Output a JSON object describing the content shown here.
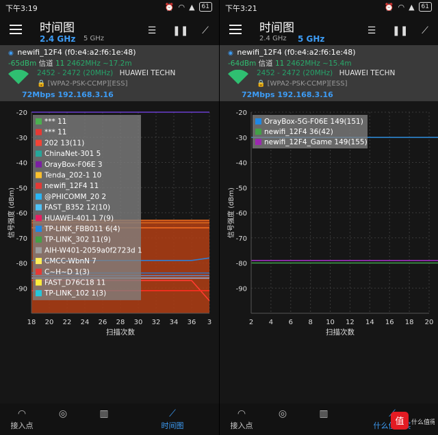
{
  "colors": {
    "accent": "#3d9cf5",
    "signal_green": "#2fbf71",
    "panel_bg": "#161616",
    "info_bg": "#3a3a3a"
  },
  "panels": [
    {
      "status_time": "下午3:19",
      "battery": "61",
      "title": "时间图",
      "band_active": "2.4 GHz",
      "band_inactive": "5 GHz",
      "ssid_line": "newifi_12F4 (f0:e4:a2:f6:1e:48)",
      "dbm": "-65dBm",
      "channel_label": "信道",
      "channel": "11",
      "freq": "2462MHz ~17.2m",
      "range": "2452 - 2472 (20MHz)",
      "vendor": "HUAWEI TECHN",
      "security": "[WPA2-PSK-CCMP][ESS]",
      "rate_ip": "72Mbps 192.168.3.16",
      "nav": [
        "接入点",
        "",
        "",
        "时间图"
      ],
      "corner_text": ""
    },
    {
      "status_time": "下午3:21",
      "battery": "61",
      "title": "时间图",
      "band_active": "5 GHz",
      "band_inactive": "2.4 GHz",
      "ssid_line": "newifi_12F4 (f0:e4:a2:f6:1e:48)",
      "dbm": "-64dBm",
      "channel_label": "信道",
      "channel": "11",
      "freq": "2462MHz ~15.4m",
      "range": "2452 - 2472 (20MHz)",
      "vendor": "HUAWEI TECHN",
      "security": "[WPA2-PSK-CCMP][ESS]",
      "rate_ip": "72Mbps 192.168.3.16",
      "nav": [
        "接入点",
        "",
        "",
        "什么值得买"
      ],
      "corner_text": "值 什么值得买"
    }
  ],
  "chart_data": [
    {
      "type": "line",
      "ylabel": "信号强度 (dBm)",
      "xlabel": "扫描次数",
      "ylim": [
        -100,
        -20
      ],
      "yticks": [
        "-20",
        "-30",
        "-40",
        "-50",
        "-60",
        "-70",
        "-80",
        "-90"
      ],
      "xticks": [
        "18",
        "20",
        "22",
        "24",
        "26",
        "28",
        "30",
        "32",
        "34",
        "36",
        "3"
      ],
      "grid": true,
      "legend_placement": "top-left",
      "legend": [
        {
          "label": "*** 11",
          "color": "#4caf50"
        },
        {
          "label": "*** 11",
          "color": "#e53935"
        },
        {
          "label": "202 13(11)",
          "color": "#f44336"
        },
        {
          "label": "ChinaNet-301 5",
          "color": "#26a69a"
        },
        {
          "label": "OrayBox-F06E 3",
          "color": "#7b1fa2"
        },
        {
          "label": "Tenda_202-1 10",
          "color": "#fbc02d"
        },
        {
          "label": "newifi_12F4 11",
          "color": "#e53935"
        },
        {
          "label": "@PHICOMM_20 2",
          "color": "#29b6f6"
        },
        {
          "label": "FAST_B352 12(10)",
          "color": "#4fc3f7"
        },
        {
          "label": "HUAWEI-401.1 7(9)",
          "color": "#e91e63"
        },
        {
          "label": "TP-LINK_FBB011 6(4)",
          "color": "#1e88e5"
        },
        {
          "label": "TP-LINK_302 11(9)",
          "color": "#43a047"
        },
        {
          "label": "AIH-W401-2059a0f2723d 1",
          "color": "#9e9e9e"
        },
        {
          "label": "CMCC-WbnN 7",
          "color": "#ffee58"
        },
        {
          "label": "C~H~D 1(3)",
          "color": "#e53935"
        },
        {
          "label": "FAST_D76C18 11",
          "color": "#ffeb3b"
        },
        {
          "label": "TP-LINK_102 1(3)",
          "color": "#26c6da"
        }
      ],
      "series": [
        {
          "color": "#6a3fd1",
          "values": [
            -20,
            -20,
            -20,
            -20,
            -20,
            -20,
            -20,
            -20,
            -20,
            -20,
            -20
          ]
        },
        {
          "color": "#e8681e",
          "values": [
            -63,
            -63,
            -63,
            -63,
            -63,
            -63,
            -63,
            -63,
            -63,
            -63,
            -63
          ]
        },
        {
          "color": "#d8651c",
          "values": [
            -64,
            -64,
            -64,
            -64,
            -64,
            -64,
            -64,
            -64,
            -64,
            -64,
            -64
          ]
        },
        {
          "color": "#f06a20",
          "values": [
            -66,
            -66,
            -66,
            -66,
            -66,
            -66,
            -66,
            -66,
            -66,
            -66,
            -66
          ]
        },
        {
          "color": "#2f7fd6",
          "values": [
            -79,
            -79,
            -79,
            -79,
            -79,
            -79,
            -79,
            -79,
            -79,
            -79,
            -78
          ]
        },
        {
          "color": "#3a6fb3",
          "values": [
            -84,
            -84,
            -84,
            -84,
            -84,
            -84,
            -84,
            -84,
            -84,
            -84,
            -84
          ]
        },
        {
          "color": "#5a86c8",
          "values": [
            -85,
            -85,
            -85,
            -85,
            -85,
            -85,
            -85,
            -85,
            -85,
            -85,
            -85
          ]
        },
        {
          "color": "#8fb2e0",
          "values": [
            -86,
            -86,
            -86,
            -86,
            -86,
            -86,
            -86,
            -86,
            -86,
            -86,
            -86
          ]
        },
        {
          "color": "#ff3b30",
          "values": [
            -87,
            -87,
            -87,
            -87,
            -87,
            -87,
            -87,
            -87,
            -87,
            -87,
            -95
          ]
        },
        {
          "color": "#ff2d20",
          "values": [
            -91,
            -91,
            -91,
            -91,
            -91,
            -91,
            -91,
            -91,
            -91,
            -91,
            -91
          ]
        }
      ]
    },
    {
      "type": "line",
      "ylabel": "信号强度 (dBm)",
      "xlabel": "扫描次数",
      "ylim": [
        -100,
        -20
      ],
      "yticks": [
        "-20",
        "-30",
        "-40",
        "-50",
        "-60",
        "-70",
        "-80",
        "-90"
      ],
      "xticks": [
        "2",
        "4",
        "6",
        "8",
        "10",
        "12",
        "14",
        "16",
        "18",
        "20"
      ],
      "grid": true,
      "legend_placement": "top-left",
      "legend": [
        {
          "label": "OrayBox-5G-F06E 149(151)",
          "color": "#1e88e5"
        },
        {
          "label": "newifi_12F4 36(42)",
          "color": "#43a047"
        },
        {
          "label": "newifi_12F4_Game 149(155)",
          "color": "#9c27b0"
        }
      ],
      "series": [
        {
          "name": "OrayBox-5G-F06E 149(151)",
          "color": "#2f8fe0",
          "values": [
            -30,
            -30,
            -30,
            -30,
            -30,
            -30,
            -30,
            -30,
            -30,
            -30,
            -30
          ]
        },
        {
          "name": "newifi_12F4 36(42)",
          "color": "#3fa34a",
          "values": [
            -80,
            -80,
            -80,
            -80,
            -80,
            -80,
            -80,
            -80,
            -80,
            -80,
            -80
          ]
        },
        {
          "name": "newifi_12F4_Game 149(155)",
          "color": "#a030c0",
          "values": [
            -79,
            -79,
            -79,
            -79,
            -79,
            -79,
            -79,
            -79,
            -79,
            -79,
            -79
          ]
        }
      ]
    }
  ]
}
